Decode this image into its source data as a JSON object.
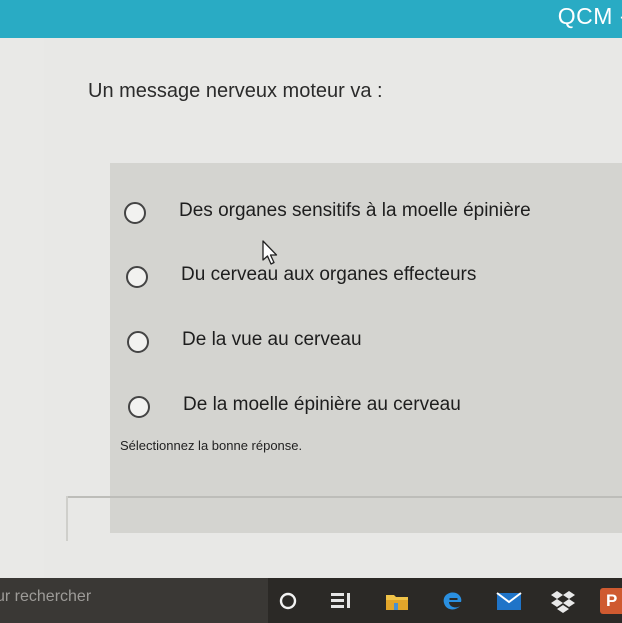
{
  "window": {
    "title": "QCM -"
  },
  "question": {
    "text": "Un message nerveux moteur va :"
  },
  "options": [
    {
      "label": "Des organes sensitifs à la moelle épinière",
      "selected": false
    },
    {
      "label": "Du cerveau aux organes effecteurs",
      "selected": false
    },
    {
      "label": "De la vue au cerveau",
      "selected": false
    },
    {
      "label": "De la moelle épinière au cerveau",
      "selected": false
    }
  ],
  "instruction": "Sélectionnez la bonne réponse.",
  "taskbar": {
    "search_placeholder": "ur rechercher",
    "icons": [
      "cortana-circle-icon",
      "task-view-icon",
      "folder-icon",
      "edge-browser-icon",
      "mail-icon",
      "dropbox-icon",
      "powerpoint-icon"
    ],
    "powerpoint_letter": "P"
  },
  "colors": {
    "header": "#29abc4",
    "page_background": "#e8e8e6",
    "answer_panel": "#d4d4d0",
    "taskbar": "#2b2926"
  }
}
